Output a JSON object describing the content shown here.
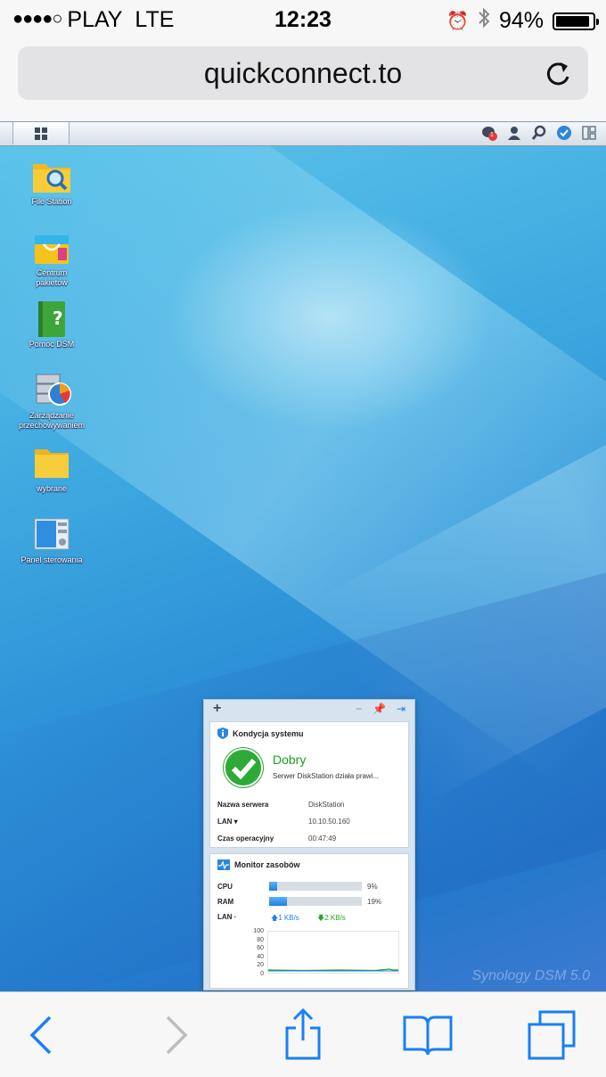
{
  "status_bar": {
    "signal": "●●●●○",
    "carrier": "PLAY",
    "network": "LTE",
    "time": "12:23",
    "battery": "94%",
    "battery_level": 0.94
  },
  "browser": {
    "url": "quickconnect.to",
    "reload_icon": "reload-icon"
  },
  "taskbar": {
    "menu_icon": "main-menu-icon",
    "right_icons": [
      "notifications-icon",
      "user-icon",
      "search-icon",
      "dsm-help-icon",
      "widgets-icon"
    ],
    "notification_count": "1"
  },
  "desktop": {
    "icons": [
      {
        "label": "File Station",
        "icon": "file-station-icon"
      },
      {
        "label": "Centrum pakietów",
        "icon": "package-center-icon"
      },
      {
        "label": "Pomoc DSM",
        "icon": "dsm-help-book-icon"
      },
      {
        "label": "Zarządzanie przechowywaniem",
        "icon": "storage-manager-icon"
      },
      {
        "label": "wybrane",
        "icon": "folder-icon"
      },
      {
        "label": "Panel sterowania",
        "icon": "control-panel-icon"
      }
    ],
    "watermark": "Synology DSM 5.0"
  },
  "widget": {
    "add_label": "+",
    "health": {
      "title": "Kondycja systemu",
      "status": "Dobry",
      "description": "Serwer DiskStation działa prawi...",
      "rows": [
        {
          "label": "Nazwa serwera",
          "value": "DiskStation"
        },
        {
          "label": "LAN ▾",
          "value": "10.10.50.160"
        },
        {
          "label": "Czas operacyjny",
          "value": "00:47:49"
        }
      ]
    },
    "monitor": {
      "title": "Monitor zasobów",
      "cpu_label": "CPU",
      "cpu_value": "9%",
      "cpu_level": 0.09,
      "ram_label": "RAM",
      "ram_value": "19%",
      "ram_level": 0.19,
      "lan_label": "LAN ·",
      "upload": "1 KB/s",
      "download": "2 KB/s",
      "ticks": [
        "100",
        "80",
        "60",
        "40",
        "20",
        "0"
      ]
    }
  },
  "toolbar": {
    "icons": [
      "back-icon",
      "forward-icon",
      "share-icon",
      "bookmarks-icon",
      "tabs-icon"
    ]
  },
  "colors": {
    "accent": "#1a7ff5",
    "ok_green": "#2eaa38",
    "upload_blue": "#1a7ff5",
    "download_green": "#28a428"
  }
}
